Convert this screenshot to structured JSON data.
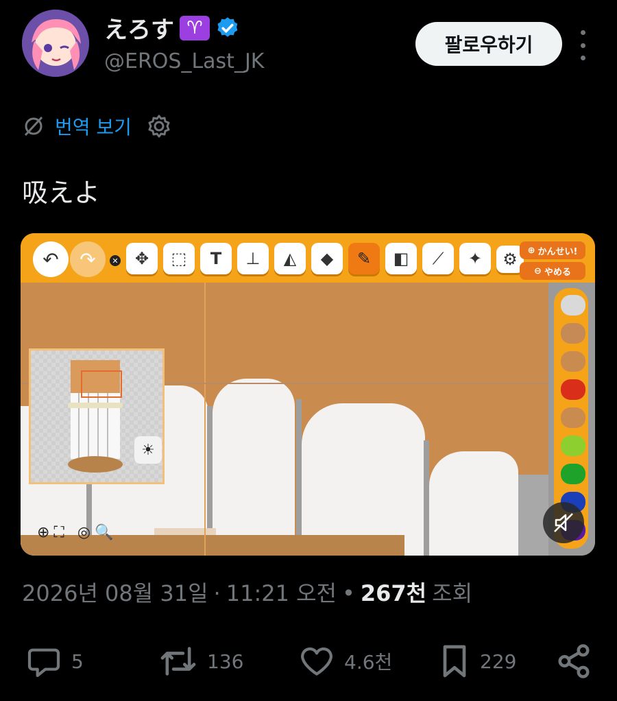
{
  "author": {
    "display_name": "えろす",
    "zodiac_emoji": "♈",
    "handle": "@EROS_Last_JK",
    "follow_label": "팔로우하기"
  },
  "translate": {
    "label": "번역 보기"
  },
  "tweet": {
    "text": "吸えよ"
  },
  "media": {
    "toolbar": {
      "done_label": "かんせい!",
      "quit_label": "やめる"
    },
    "palette_colors": [
      "#d9d9d9",
      "#c58a55",
      "#c98b4e",
      "#d92f1a",
      "#c98b4e",
      "#8ccf2e",
      "#1fa22a",
      "#1a3fb8",
      "#5a1aa8"
    ]
  },
  "meta": {
    "date": "2026년 08월 31일",
    "time": "11:21 오전",
    "views_count": "267천",
    "views_label": "조회"
  },
  "actions": {
    "replies": "5",
    "reposts": "136",
    "likes": "4.6천",
    "bookmarks": "229"
  },
  "colors": {
    "accent": "#1d9bf0",
    "background": "#000000",
    "muted": "#71767b"
  }
}
